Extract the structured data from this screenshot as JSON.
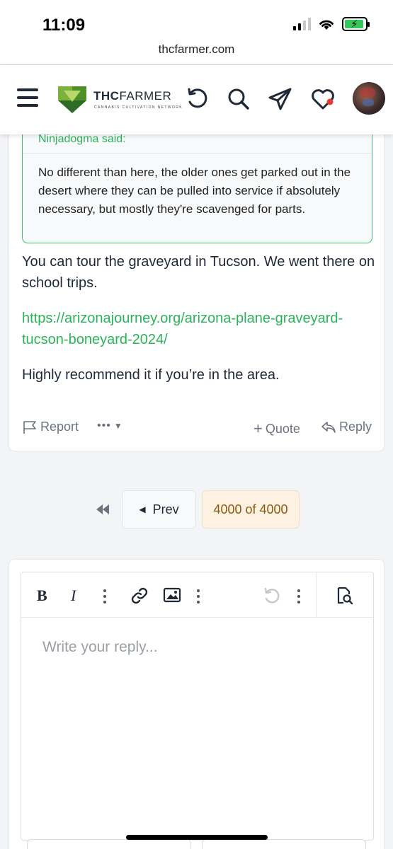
{
  "status_bar": {
    "time": "11:09",
    "url": "thcfarmer.com"
  },
  "header": {
    "logo_bold": "THC",
    "logo_light": "FARMER",
    "logo_tagline": "CANNABIS CULTIVATION NETWORK"
  },
  "post": {
    "quote_author": "Ninjadogma said:",
    "quote_text": "No different than here, the older ones get parked out in the desert where they can be pulled into service if absolutely necessary, but mostly they're scavenged for parts.",
    "paragraph1": "You can tour the graveyard in Tucson. We went there on school trips.",
    "link": "https://arizonajourney.org/arizona-plane-graveyard-tucson-boneyard-2024/",
    "paragraph3": "Highly recommend it if you’re in the area.",
    "actions": {
      "report": "Report",
      "quote": "Quote",
      "reply": "Reply"
    }
  },
  "pagination": {
    "prev": "Prev",
    "current": "4000 of 4000"
  },
  "editor": {
    "placeholder": "Write your reply..."
  },
  "colors": {
    "accent_green": "#2bb35a",
    "page_bg": "#f3f4f6"
  }
}
